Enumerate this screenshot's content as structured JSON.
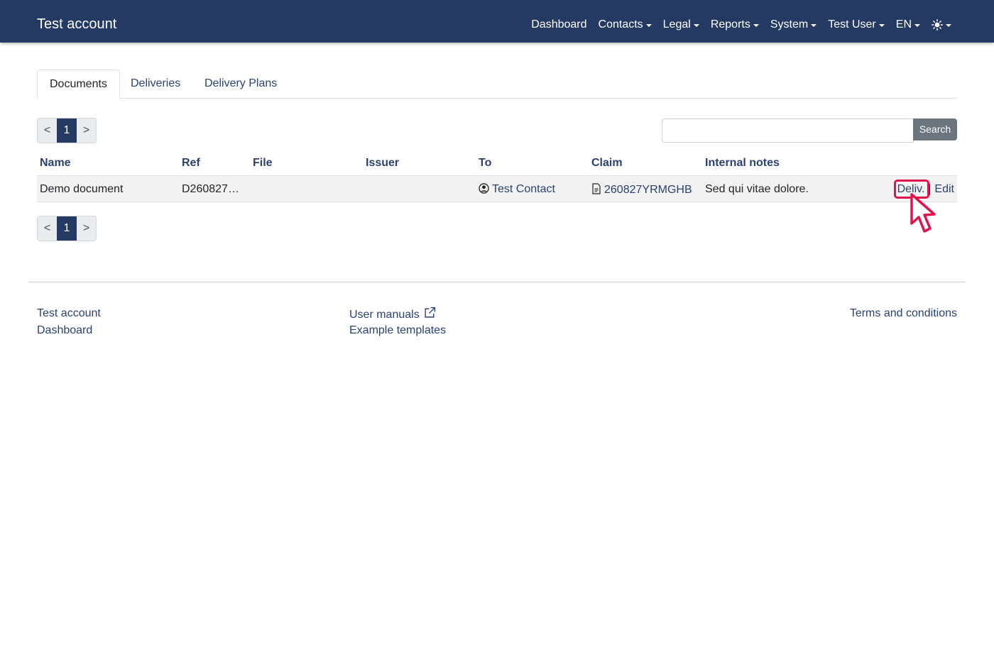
{
  "navbar": {
    "brand": "Test account",
    "links": [
      "Dashboard",
      "Contacts",
      "Legal",
      "Reports",
      "System",
      "Test User",
      "EN"
    ],
    "theme_icon": "sun-icon"
  },
  "tabs": [
    "Documents",
    "Deliveries",
    "Delivery Plans"
  ],
  "pagination": {
    "prev": "<",
    "current": "1",
    "next": ">"
  },
  "search": {
    "button_label": "Search",
    "value": ""
  },
  "table": {
    "headers": [
      "Name",
      "Ref",
      "File",
      "Issuer",
      "To",
      "Claim",
      "Internal notes"
    ],
    "rows": [
      {
        "name": "Demo document",
        "ref": "D260827…",
        "file": "",
        "issuer": "",
        "to": "Test Contact",
        "claim": "260827YRMGHB",
        "notes": "Sed qui vitae dolore.",
        "action_deliveries": "Deliv.",
        "action_edit": "Edit"
      }
    ]
  },
  "footer": {
    "col1": [
      "Test account",
      "Dashboard"
    ],
    "col2": [
      "User manuals",
      "Example templates"
    ],
    "col3": [
      "Terms and conditions"
    ]
  },
  "colors": {
    "navbar": "#253a62",
    "link": "#2a4172",
    "highlight": "#e0144c"
  }
}
